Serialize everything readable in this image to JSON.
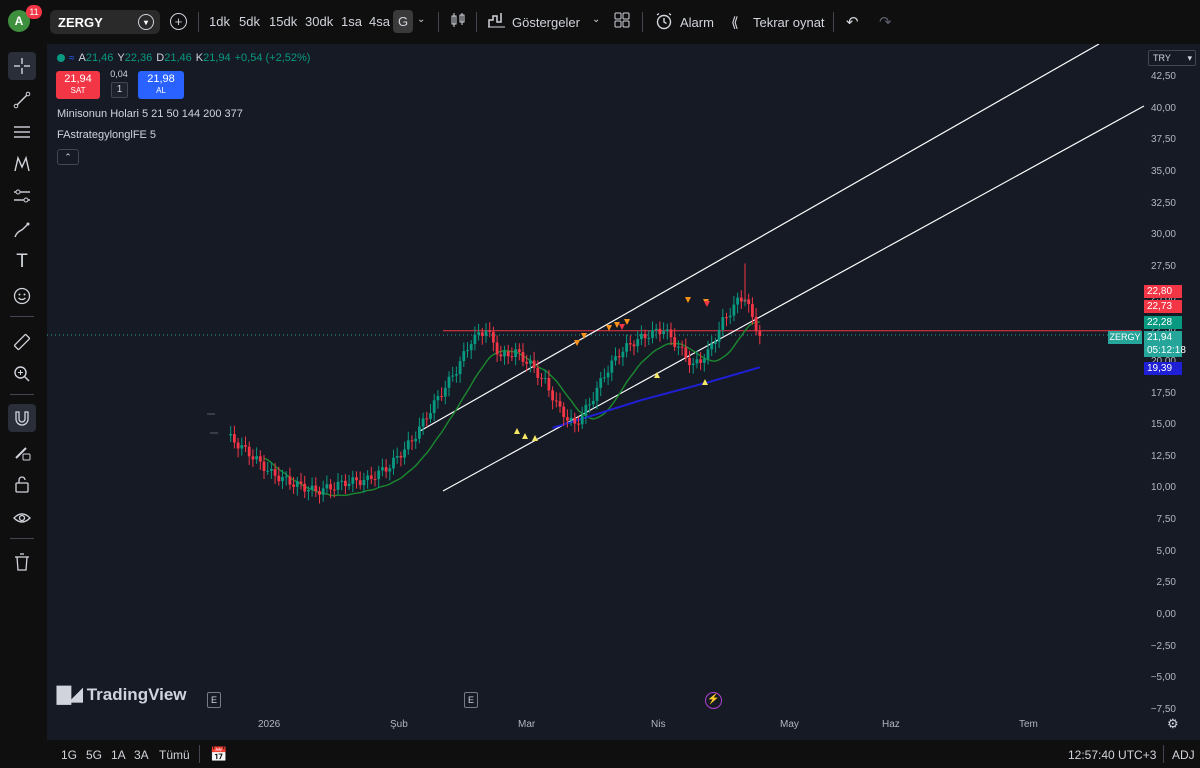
{
  "user": {
    "initial": "A",
    "notifications": "11"
  },
  "symbol": "ZERGY",
  "timeframes": [
    "1dk",
    "5dk",
    "15dk",
    "30dk",
    "1sa",
    "4sa",
    "G"
  ],
  "active_timeframe": "G",
  "toolbar": {
    "indicators": "Göstergeler",
    "alarm": "Alarm",
    "replay": "Tekrar oynat"
  },
  "legend": {
    "open_label": "A",
    "open": "21,46",
    "high_label": "Y",
    "high": "22,36",
    "low_label": "D",
    "low": "21,46",
    "close_label": "K",
    "close": "21,94",
    "change": "+0,54 (+2,52%)"
  },
  "trade": {
    "sell_price": "21,94",
    "sell_label": "SAT",
    "spread": "0,04",
    "qty": "1",
    "buy_price": "21,98",
    "buy_label": "AL"
  },
  "indicators": [
    "Minisonun Holari 5 21 50 144 200 377",
    "FAstrategylonglFE 5"
  ],
  "price_axis": {
    "currency": "TRY",
    "ticks": [
      "42,50",
      "40,00",
      "37,50",
      "35,00",
      "32,50",
      "30,00",
      "27,50",
      "25,00",
      "22,50",
      "20,00",
      "17,50",
      "15,00",
      "12,50",
      "10,00",
      "7,50",
      "5,00",
      "2,50",
      "0,00",
      "−2,50",
      "−5,00",
      "−7,50"
    ],
    "badges": [
      {
        "value": "22,80",
        "color": "#f23645"
      },
      {
        "value": "22,73",
        "color": "#f23645"
      },
      {
        "value": "22,28",
        "color": "#089981"
      },
      {
        "value": "21,94",
        "color": "#26a69a"
      },
      {
        "value": "05:12:18",
        "color": "#26a69a"
      },
      {
        "value": "19,39",
        "color": "#1f1fd6"
      }
    ],
    "symbol_badge": "ZERGY"
  },
  "time_axis": [
    "2026",
    "Şub",
    "Mar",
    "Nis",
    "May",
    "Haz",
    "Tem"
  ],
  "branding": "TradingView",
  "events_label": "E",
  "bottom": {
    "ranges": [
      "1G",
      "5G",
      "1A",
      "3A",
      "Tümü"
    ],
    "clock": "12:57:40 UTC+3",
    "adj": "ADJ"
  },
  "colors": {
    "up": "#089981",
    "down": "#f23645",
    "background": "#161a25",
    "channel": "#ffffff",
    "ma_green": "#1b8a2f",
    "ma_blue": "#1f1fd6"
  }
}
